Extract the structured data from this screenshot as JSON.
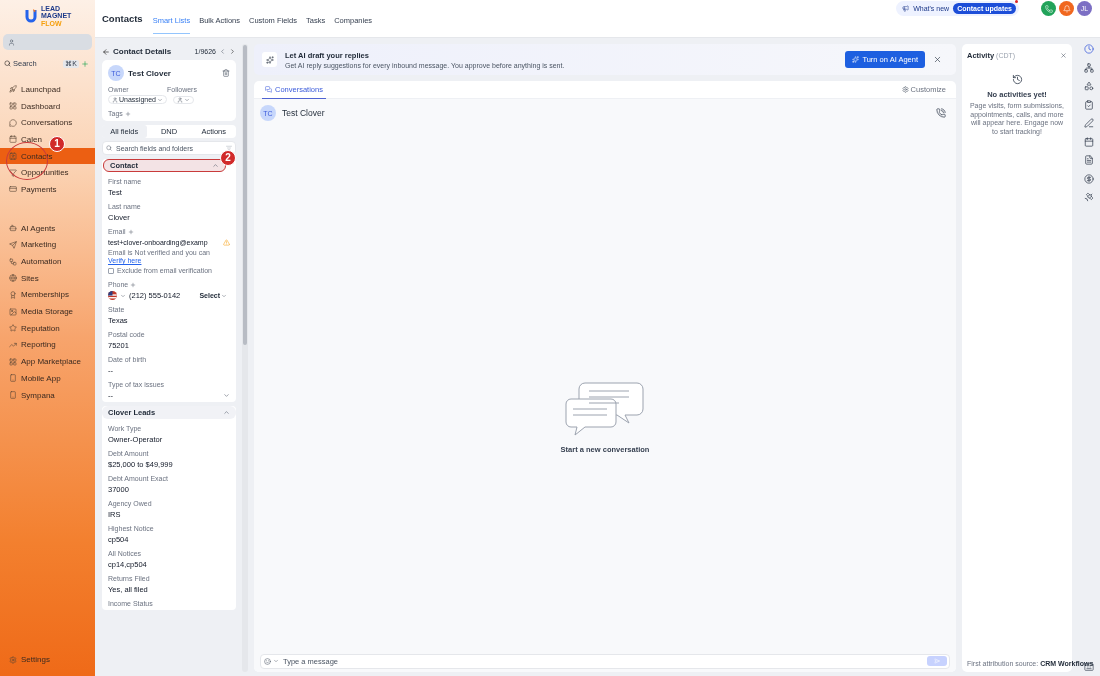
{
  "logo": {
    "lines": [
      "LEAD",
      "MAGNET",
      "FLOW"
    ]
  },
  "sidebar": {
    "search": {
      "placeholder": "Search",
      "shortcut": "⌘K"
    },
    "groups": [
      [
        {
          "label": "Launchpad",
          "selected": false
        },
        {
          "label": "Dashboard",
          "selected": false
        },
        {
          "label": "Conversations",
          "selected": false
        },
        {
          "label": "Calen",
          "selected": false
        },
        {
          "label": "Contacts",
          "selected": true,
          "annotation": "1"
        },
        {
          "label": "Opportunities",
          "selected": false
        },
        {
          "label": "Payments",
          "selected": false
        }
      ],
      [
        {
          "label": "AI Agents",
          "selected": false
        },
        {
          "label": "Marketing",
          "selected": false
        },
        {
          "label": "Automation",
          "selected": false
        },
        {
          "label": "Sites",
          "selected": false
        },
        {
          "label": "Memberships",
          "selected": false
        },
        {
          "label": "Media Storage",
          "selected": false
        },
        {
          "label": "Reputation",
          "selected": false
        },
        {
          "label": "Reporting",
          "selected": false
        },
        {
          "label": "App Marketplace",
          "selected": false
        },
        {
          "label": "Mobile App",
          "selected": false
        },
        {
          "label": "Sympana",
          "selected": false
        }
      ]
    ],
    "settings": "Settings"
  },
  "header": {
    "title": "Contacts",
    "tabs": [
      {
        "label": "Smart Lists",
        "selected": true
      },
      {
        "label": "Bulk Actions",
        "selected": false
      },
      {
        "label": "Custom Fields",
        "selected": false
      },
      {
        "label": "Tasks",
        "selected": false
      },
      {
        "label": "Companies",
        "selected": false
      }
    ],
    "whats_new": "What's new",
    "updates": "Contact updates",
    "avatar": "JL"
  },
  "contact_panel": {
    "title": "Contact Details",
    "position": "1/9626",
    "initials": "TC",
    "name": "Test Clover",
    "owner_label": "Owner",
    "owner": "Unassigned",
    "followers_label": "Followers",
    "tags_label": "Tags",
    "tabs": [
      {
        "label": "All fields",
        "selected": true
      },
      {
        "label": "DND",
        "selected": false
      },
      {
        "label": "Actions",
        "selected": false
      }
    ],
    "search_placeholder": "Search fields and folders",
    "sections": [
      {
        "title": "Contact",
        "expanded": true,
        "annotation": "2",
        "fields": [
          {
            "kind": "text",
            "label": "First name",
            "value": "Test"
          },
          {
            "kind": "text",
            "label": "Last name",
            "value": "Clover"
          },
          {
            "kind": "email",
            "label": "Email",
            "value": "test+clover-onboarding@examp",
            "note": "Email is Not verified and you can",
            "link": "Verify here",
            "exclude": "Exclude from email verification",
            "checked": false
          },
          {
            "kind": "phone",
            "label": "Phone",
            "value": "(212) 555-0142",
            "select": "Select"
          },
          {
            "kind": "text",
            "label": "State",
            "value": "Texas"
          },
          {
            "kind": "text",
            "label": "Postal code",
            "value": "75201"
          },
          {
            "kind": "text",
            "label": "Date of birth",
            "value": "--"
          },
          {
            "kind": "dropdown",
            "label": "Type of tax issues",
            "value": "--"
          }
        ]
      },
      {
        "title": "Clover Leads",
        "expanded": true,
        "fields": [
          {
            "kind": "text",
            "label": "Work Type",
            "value": "Owner-Operator"
          },
          {
            "kind": "text",
            "label": "Debt Amount",
            "value": "$25,000 to $49,999"
          },
          {
            "kind": "text",
            "label": "Debt Amount Exact",
            "value": "37000"
          },
          {
            "kind": "text",
            "label": "Agency Owed",
            "value": "IRS"
          },
          {
            "kind": "text",
            "label": "Highest Notice",
            "value": "cp504"
          },
          {
            "kind": "text",
            "label": "All Notices",
            "value": "cp14,cp504"
          },
          {
            "kind": "text",
            "label": "Returns Filed",
            "value": "Yes, all filed"
          },
          {
            "kind": "label",
            "label": "Income Status"
          }
        ]
      }
    ]
  },
  "ai_banner": {
    "title": "Let AI draft your replies",
    "text": "Get AI reply suggestions for every inbound message. You approve before anything is sent.",
    "button": "Turn on AI Agent"
  },
  "conversation": {
    "tab": "Conversations",
    "customize": "Customize",
    "initials": "TC",
    "name": "Test Clover",
    "empty": "Start a new conversation",
    "placeholder": "Type a message"
  },
  "activity": {
    "title": "Activity",
    "zone": "(CDT)",
    "empty_title": "No activities yet!",
    "empty_text": "Page visits, form submissions, appointments, calls, and more will appear here. Engage now to start tracking!",
    "footer_label": "First attribution source:",
    "footer_value": "CRM Workflows"
  }
}
